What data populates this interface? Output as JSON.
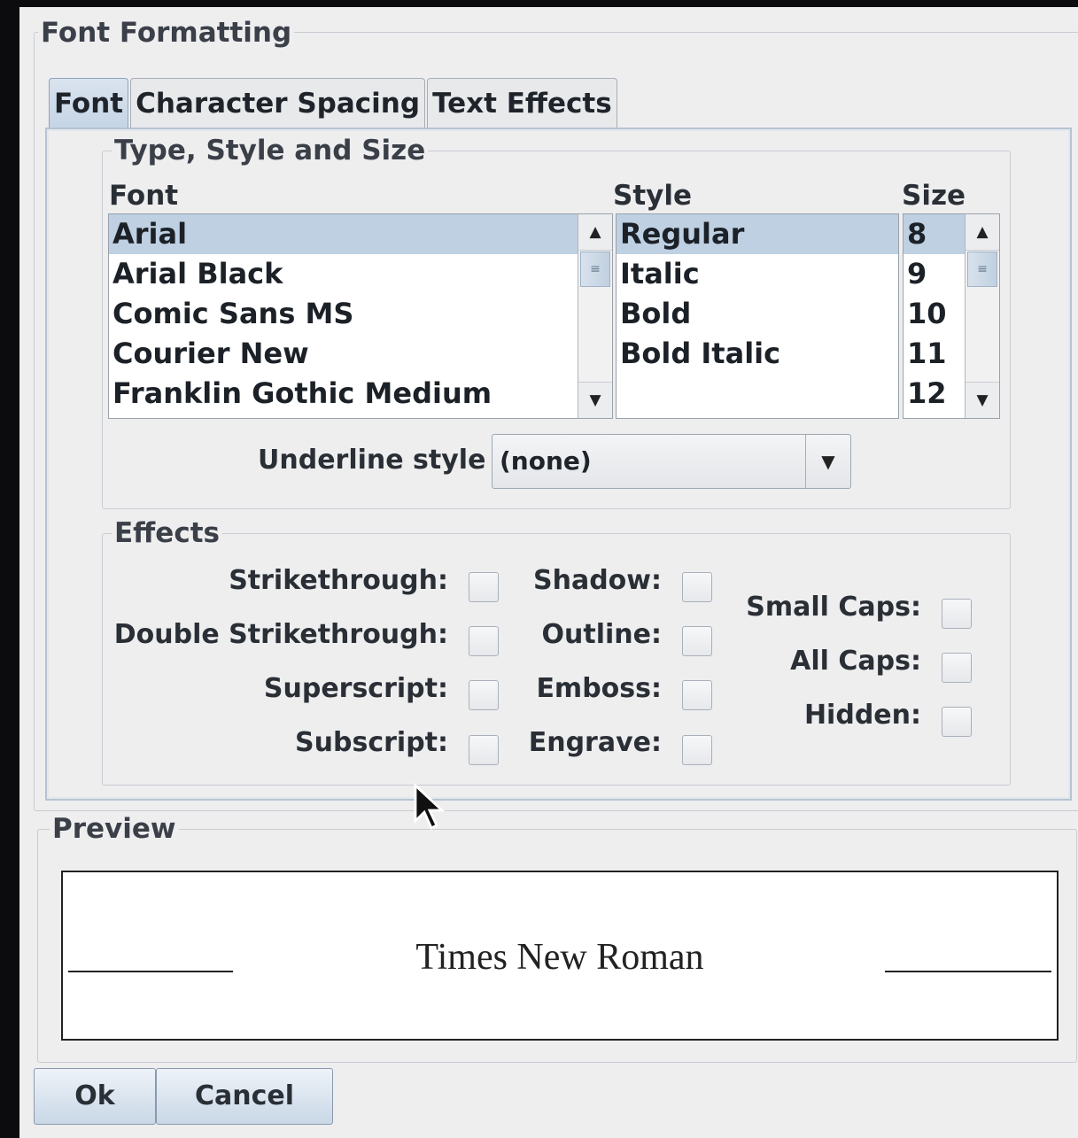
{
  "window": {
    "title": "Font Formatting"
  },
  "tabs": [
    {
      "label": "Font",
      "active": true
    },
    {
      "label": "Character Spacing",
      "active": false
    },
    {
      "label": "Text Effects",
      "active": false
    }
  ],
  "type_style_size": {
    "title": "Type, Style and Size",
    "font": {
      "label": "Font",
      "items": [
        "Arial",
        "Arial Black",
        "Comic Sans MS",
        "Courier New",
        "Franklin Gothic Medium"
      ],
      "selected": "Arial"
    },
    "style": {
      "label": "Style",
      "items": [
        "Regular",
        "Italic",
        "Bold",
        "Bold Italic"
      ],
      "selected": "Regular"
    },
    "size": {
      "label": "Size",
      "items": [
        "8",
        "9",
        "10",
        "11",
        "12"
      ],
      "selected": "8"
    },
    "underline": {
      "label": "Underline style",
      "value": "(none)"
    }
  },
  "effects": {
    "title": "Effects",
    "col1": [
      {
        "label": "Strikethrough:",
        "checked": false
      },
      {
        "label": "Double Strikethrough:",
        "checked": false
      },
      {
        "label": "Superscript:",
        "checked": false
      },
      {
        "label": "Subscript:",
        "checked": false
      }
    ],
    "col2": [
      {
        "label": "Shadow:",
        "checked": false
      },
      {
        "label": "Outline:",
        "checked": false
      },
      {
        "label": "Emboss:",
        "checked": false
      },
      {
        "label": "Engrave:",
        "checked": false
      }
    ],
    "col3": [
      {
        "label": "Small Caps:",
        "checked": false
      },
      {
        "label": "All Caps:",
        "checked": false
      },
      {
        "label": "Hidden:",
        "checked": false
      }
    ]
  },
  "preview": {
    "title": "Preview",
    "sample_text": "Times New Roman"
  },
  "buttons": {
    "ok": "Ok",
    "cancel": "Cancel"
  },
  "icons": {
    "scroll_up": "scroll-up-arrow-icon",
    "scroll_down": "scroll-down-arrow-icon",
    "dropdown": "chevron-down-icon",
    "cursor": "mouse-pointer-icon"
  }
}
